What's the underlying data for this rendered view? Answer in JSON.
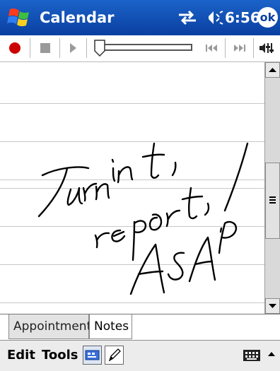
{
  "title_bar": {
    "app_title": "Calendar",
    "clock": "6:56",
    "ok_label": "ok",
    "icons": [
      "windows-start-icon",
      "connectivity-icon",
      "speaker-icon"
    ],
    "accent_color": "#0a3fa0"
  },
  "media_toolbar": {
    "icons": [
      "record-icon",
      "stop-icon",
      "play-icon",
      "position-slider",
      "skip-back-icon",
      "skip-forward-icon",
      "volume-icon"
    ],
    "record_color": "#cc0000",
    "playback_position": 0
  },
  "note": {
    "handwriting": [
      "Turn in",
      "report,",
      "ASAP!"
    ]
  },
  "tabs": [
    {
      "label": "Appointment",
      "selected": false
    },
    {
      "label": "Notes",
      "selected": true
    }
  ],
  "menu_bar": {
    "edit_label": "Edit",
    "tools_label": "Tools",
    "icons": [
      "keyboard-view-icon",
      "pen-icon",
      "input-panel-keyboard-icon",
      "input-panel-arrow-icon"
    ]
  }
}
